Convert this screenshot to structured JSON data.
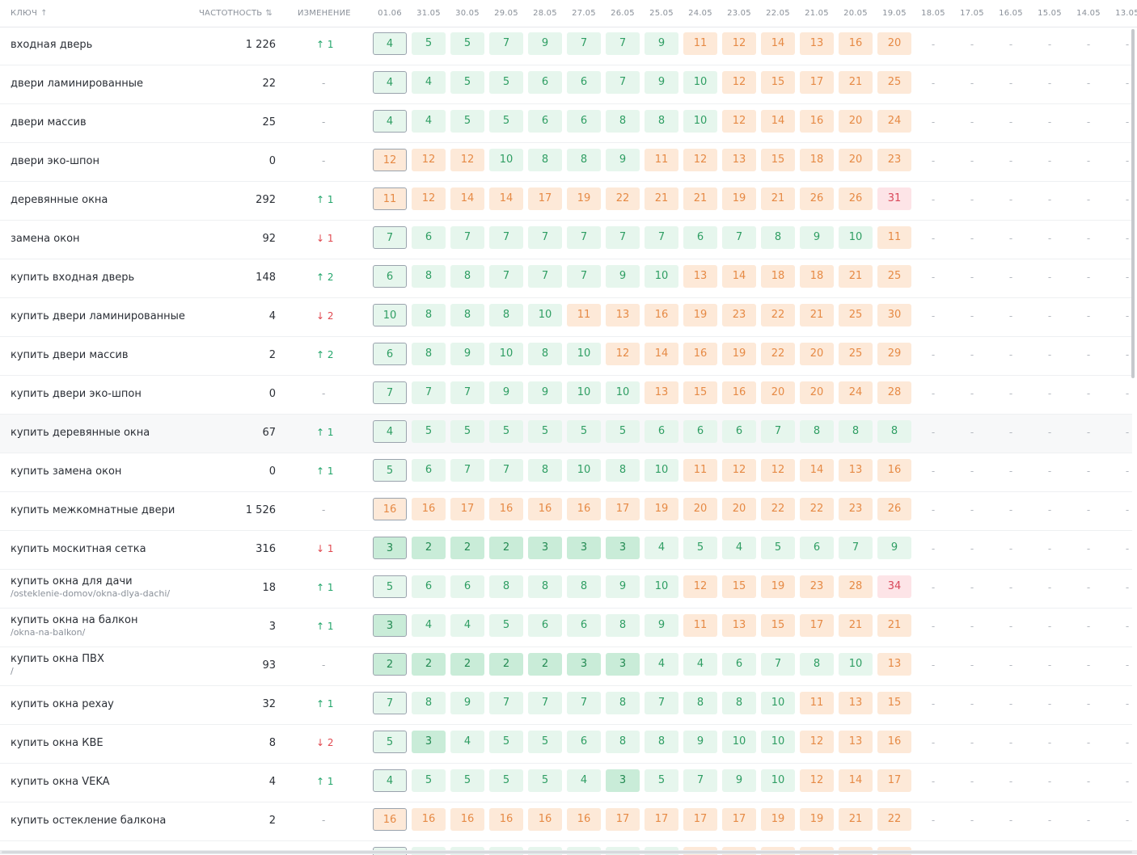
{
  "header": {
    "key_label": "КЛЮЧ",
    "key_sort_icon": "↑",
    "freq_label": "ЧАСТОТНОСТЬ",
    "freq_sort_icon": "⇅",
    "change_label": "ИЗМЕНЕНИЕ",
    "dates": [
      "01.06",
      "31.05",
      "30.05",
      "29.05",
      "28.05",
      "27.05",
      "26.05",
      "25.05",
      "24.05",
      "23.05",
      "22.05",
      "21.05",
      "20.05",
      "19.05",
      "18.05",
      "17.05",
      "16.05",
      "15.05",
      "14.05",
      "13.05"
    ]
  },
  "empty_value": "-",
  "colors": {
    "green": "#e6f6ed",
    "green_strong": "#c9ecd8",
    "orange": "#fde9d8",
    "red": "#fde4e7",
    "up": "#22a56a",
    "down": "#e0484f"
  },
  "rows": [
    {
      "keyword": "входная дверь",
      "url": "",
      "freq": "1 226",
      "change": {
        "dir": "up",
        "text": "↑ 1"
      },
      "positions": [
        4,
        5,
        5,
        7,
        9,
        7,
        7,
        9,
        11,
        12,
        14,
        13,
        16,
        20
      ]
    },
    {
      "keyword": "двери ламинированные",
      "url": "",
      "freq": "22",
      "change": {
        "dir": "none",
        "text": "-"
      },
      "positions": [
        4,
        4,
        5,
        5,
        6,
        6,
        7,
        9,
        10,
        12,
        15,
        17,
        21,
        25
      ]
    },
    {
      "keyword": "двери массив",
      "url": "",
      "freq": "25",
      "change": {
        "dir": "none",
        "text": "-"
      },
      "positions": [
        4,
        4,
        5,
        5,
        6,
        6,
        8,
        8,
        10,
        12,
        14,
        16,
        20,
        24
      ]
    },
    {
      "keyword": "двери эко-шпон",
      "url": "",
      "freq": "0",
      "change": {
        "dir": "none",
        "text": "-"
      },
      "positions": [
        12,
        12,
        12,
        10,
        8,
        8,
        9,
        11,
        12,
        13,
        15,
        18,
        20,
        23
      ]
    },
    {
      "keyword": "деревянные окна",
      "url": "",
      "freq": "292",
      "change": {
        "dir": "up",
        "text": "↑ 1"
      },
      "positions": [
        11,
        12,
        14,
        14,
        17,
        19,
        22,
        21,
        21,
        19,
        21,
        26,
        26,
        31
      ]
    },
    {
      "keyword": "замена окон",
      "url": "",
      "freq": "92",
      "change": {
        "dir": "down",
        "text": "↓ 1"
      },
      "positions": [
        7,
        6,
        7,
        7,
        7,
        7,
        7,
        7,
        6,
        7,
        8,
        9,
        10,
        11
      ]
    },
    {
      "keyword": "купить входная дверь",
      "url": "",
      "freq": "148",
      "change": {
        "dir": "up",
        "text": "↑ 2"
      },
      "positions": [
        6,
        8,
        8,
        7,
        7,
        7,
        9,
        10,
        13,
        14,
        18,
        18,
        21,
        25
      ]
    },
    {
      "keyword": "купить двери ламинированные",
      "url": "",
      "freq": "4",
      "change": {
        "dir": "down",
        "text": "↓ 2"
      },
      "positions": [
        10,
        8,
        8,
        8,
        10,
        11,
        13,
        16,
        19,
        23,
        22,
        21,
        25,
        30
      ]
    },
    {
      "keyword": "купить двери массив",
      "url": "",
      "freq": "2",
      "change": {
        "dir": "up",
        "text": "↑ 2"
      },
      "positions": [
        6,
        8,
        9,
        10,
        8,
        10,
        12,
        14,
        16,
        19,
        22,
        20,
        25,
        29
      ]
    },
    {
      "keyword": "купить двери эко-шпон",
      "url": "",
      "freq": "0",
      "change": {
        "dir": "none",
        "text": "-"
      },
      "positions": [
        7,
        7,
        7,
        9,
        9,
        10,
        10,
        13,
        15,
        16,
        20,
        20,
        24,
        28
      ]
    },
    {
      "keyword": "купить деревянные окна",
      "url": "",
      "freq": "67",
      "change": {
        "dir": "up",
        "text": "↑ 1"
      },
      "positions": [
        4,
        5,
        5,
        5,
        5,
        5,
        5,
        6,
        6,
        6,
        7,
        8,
        8,
        8
      ],
      "highlighted": true
    },
    {
      "keyword": "купить замена окон",
      "url": "",
      "freq": "0",
      "change": {
        "dir": "up",
        "text": "↑ 1"
      },
      "positions": [
        5,
        6,
        7,
        7,
        8,
        10,
        8,
        10,
        11,
        12,
        12,
        14,
        13,
        16
      ]
    },
    {
      "keyword": "купить межкомнатные двери",
      "url": "",
      "freq": "1 526",
      "change": {
        "dir": "none",
        "text": "-"
      },
      "positions": [
        16,
        16,
        17,
        16,
        16,
        16,
        17,
        19,
        20,
        20,
        22,
        22,
        23,
        26
      ]
    },
    {
      "keyword": "купить москитная сетка",
      "url": "",
      "freq": "316",
      "change": {
        "dir": "down",
        "text": "↓ 1"
      },
      "positions": [
        3,
        2,
        2,
        2,
        3,
        3,
        3,
        4,
        5,
        4,
        5,
        6,
        7,
        9
      ]
    },
    {
      "keyword": "купить окна для дачи",
      "url": "/osteklenie-domov/okna-dlya-dachi/",
      "freq": "18",
      "change": {
        "dir": "up",
        "text": "↑ 1"
      },
      "positions": [
        5,
        6,
        6,
        8,
        8,
        8,
        9,
        10,
        12,
        15,
        19,
        23,
        28,
        34
      ]
    },
    {
      "keyword": "купить окна на балкон",
      "url": "/okna-na-balkon/",
      "freq": "3",
      "change": {
        "dir": "up",
        "text": "↑ 1"
      },
      "positions": [
        3,
        4,
        4,
        5,
        6,
        6,
        8,
        9,
        11,
        13,
        15,
        17,
        21,
        21
      ]
    },
    {
      "keyword": "купить окна ПВХ",
      "url": "/",
      "freq": "93",
      "change": {
        "dir": "none",
        "text": "-"
      },
      "positions": [
        2,
        2,
        2,
        2,
        2,
        3,
        3,
        4,
        4,
        6,
        7,
        8,
        10,
        13
      ]
    },
    {
      "keyword": "купить окна рехау",
      "url": "",
      "freq": "32",
      "change": {
        "dir": "up",
        "text": "↑ 1"
      },
      "positions": [
        7,
        8,
        9,
        7,
        7,
        7,
        8,
        7,
        8,
        8,
        10,
        11,
        13,
        15
      ]
    },
    {
      "keyword": "купить окна КВЕ",
      "url": "",
      "freq": "8",
      "change": {
        "dir": "down",
        "text": "↓ 2"
      },
      "positions": [
        5,
        3,
        4,
        5,
        5,
        6,
        8,
        8,
        9,
        10,
        10,
        12,
        13,
        16
      ]
    },
    {
      "keyword": "купить окна VEKA",
      "url": "",
      "freq": "4",
      "change": {
        "dir": "up",
        "text": "↑ 1"
      },
      "positions": [
        4,
        5,
        5,
        5,
        5,
        4,
        3,
        5,
        7,
        9,
        10,
        12,
        14,
        17
      ]
    },
    {
      "keyword": "купить остекление балкона",
      "url": "",
      "freq": "2",
      "change": {
        "dir": "none",
        "text": "-"
      },
      "positions": [
        16,
        16,
        16,
        16,
        16,
        16,
        17,
        17,
        17,
        17,
        19,
        19,
        21,
        22
      ]
    }
  ]
}
